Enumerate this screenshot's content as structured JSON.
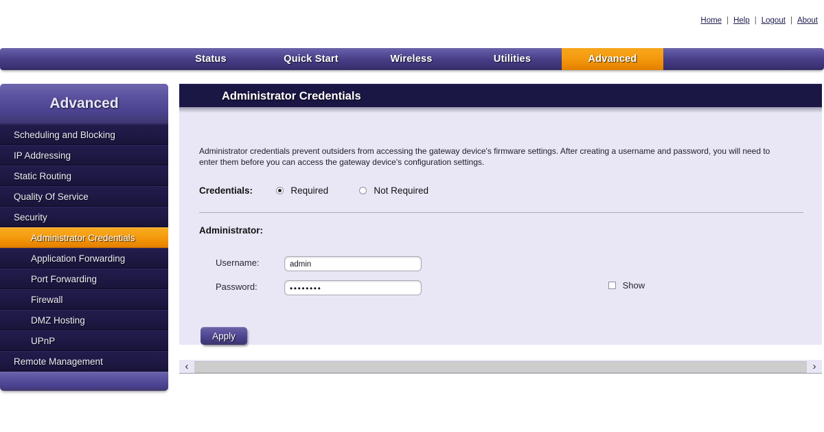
{
  "toplinks": {
    "items": [
      {
        "label": "Home"
      },
      {
        "label": "Help"
      },
      {
        "label": "Logout"
      },
      {
        "label": "About"
      }
    ],
    "separator": "|"
  },
  "nav": {
    "items": [
      {
        "label": "Status",
        "active": false
      },
      {
        "label": "Quick Start",
        "active": false
      },
      {
        "label": "Wireless",
        "active": false
      },
      {
        "label": "Utilities",
        "active": false
      },
      {
        "label": "Advanced",
        "active": true
      }
    ],
    "active_color": "#f59c10",
    "bar_color": "#463d86"
  },
  "sidebar": {
    "title": "Advanced",
    "items": [
      {
        "label": "Scheduling and Blocking",
        "sub": false,
        "active": false
      },
      {
        "label": "IP Addressing",
        "sub": false,
        "active": false
      },
      {
        "label": "Static Routing",
        "sub": false,
        "active": false
      },
      {
        "label": "Quality Of Service",
        "sub": false,
        "active": false
      },
      {
        "label": "Security",
        "sub": false,
        "active": false
      },
      {
        "label": "Administrator Credentials",
        "sub": true,
        "active": true
      },
      {
        "label": "Application Forwarding",
        "sub": true,
        "active": false
      },
      {
        "label": "Port Forwarding",
        "sub": true,
        "active": false
      },
      {
        "label": "Firewall",
        "sub": true,
        "active": false
      },
      {
        "label": "DMZ Hosting",
        "sub": true,
        "active": false
      },
      {
        "label": "UPnP",
        "sub": true,
        "active": false
      },
      {
        "label": "Remote Management",
        "sub": false,
        "active": false
      }
    ]
  },
  "panel": {
    "title": "Administrator Credentials",
    "description": "Administrator credentials prevent outsiders from accessing the gateway device's firmware settings. After creating a username and password, you will need to enter them before you can access the gateway device's configuration settings.",
    "credentials": {
      "label": "Credentials:",
      "options": [
        {
          "label": "Required",
          "selected": true
        },
        {
          "label": "Not Required",
          "selected": false
        }
      ]
    },
    "administrator": {
      "section_label": "Administrator:",
      "username_label": "Username:",
      "username_value": "admin",
      "password_label": "Password:",
      "password_value": "••••••••",
      "show_label": "Show",
      "show_checked": false
    },
    "apply_label": "Apply",
    "scrollbar": {
      "left_arrow": "‹",
      "right_arrow": "›"
    }
  }
}
